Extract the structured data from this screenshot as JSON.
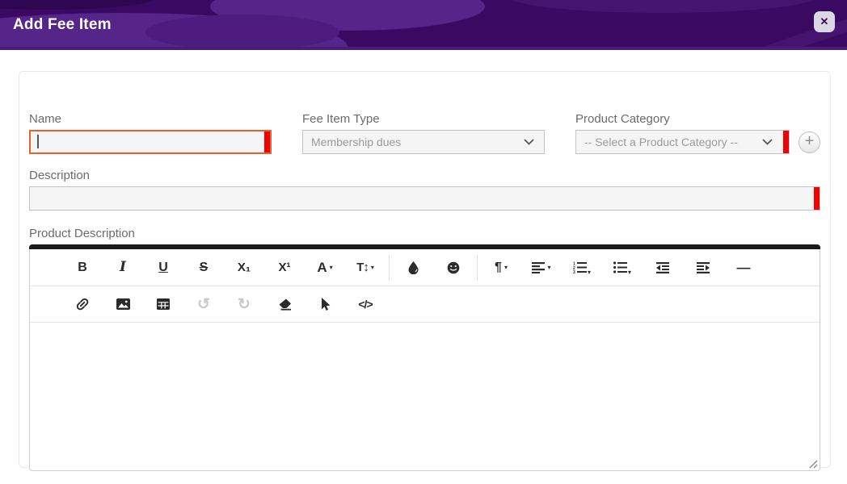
{
  "header": {
    "title": "Add Fee Item",
    "close_icon": "✕"
  },
  "form": {
    "name": {
      "label": "Name",
      "value": ""
    },
    "fee_item_type": {
      "label": "Fee Item Type",
      "selected_option": "Membership dues"
    },
    "product_category": {
      "label": "Product Category",
      "selected_option": "-- Select a Product Category --",
      "add_button_glyph": "+"
    },
    "description": {
      "label": "Description",
      "value": ""
    },
    "product_description": {
      "label": "Product Description",
      "value": ""
    }
  },
  "editor": {
    "glyphs": {
      "bold": "B",
      "italic": "I",
      "underline": "U",
      "strikethrough": "S",
      "subscript": "X₁",
      "superscript": "X¹",
      "font_color": "A",
      "font_size": "T↕",
      "paragraph": "¶",
      "horizontal_line": "—",
      "code_view": "</>",
      "undo": "↺",
      "redo": "↻",
      "caret": "▾"
    },
    "toolbar_row1": [
      "bold",
      "italic",
      "underline",
      "strikethrough",
      "subscript",
      "superscript",
      "font-color",
      "font-size",
      "highlight-color",
      "emoticons",
      "paragraph-format",
      "align",
      "ordered-list",
      "unordered-list",
      "outdent",
      "indent",
      "horizontal-line"
    ],
    "toolbar_row2": [
      "insert-link",
      "insert-image",
      "insert-table",
      "undo",
      "redo",
      "clear-formatting",
      "select-all",
      "code-view"
    ]
  },
  "colors": {
    "header_background": "#3a0a62",
    "header_pattern": "#55258a",
    "required_indicator": "#ee0202",
    "focused_border": "#e8602c"
  }
}
